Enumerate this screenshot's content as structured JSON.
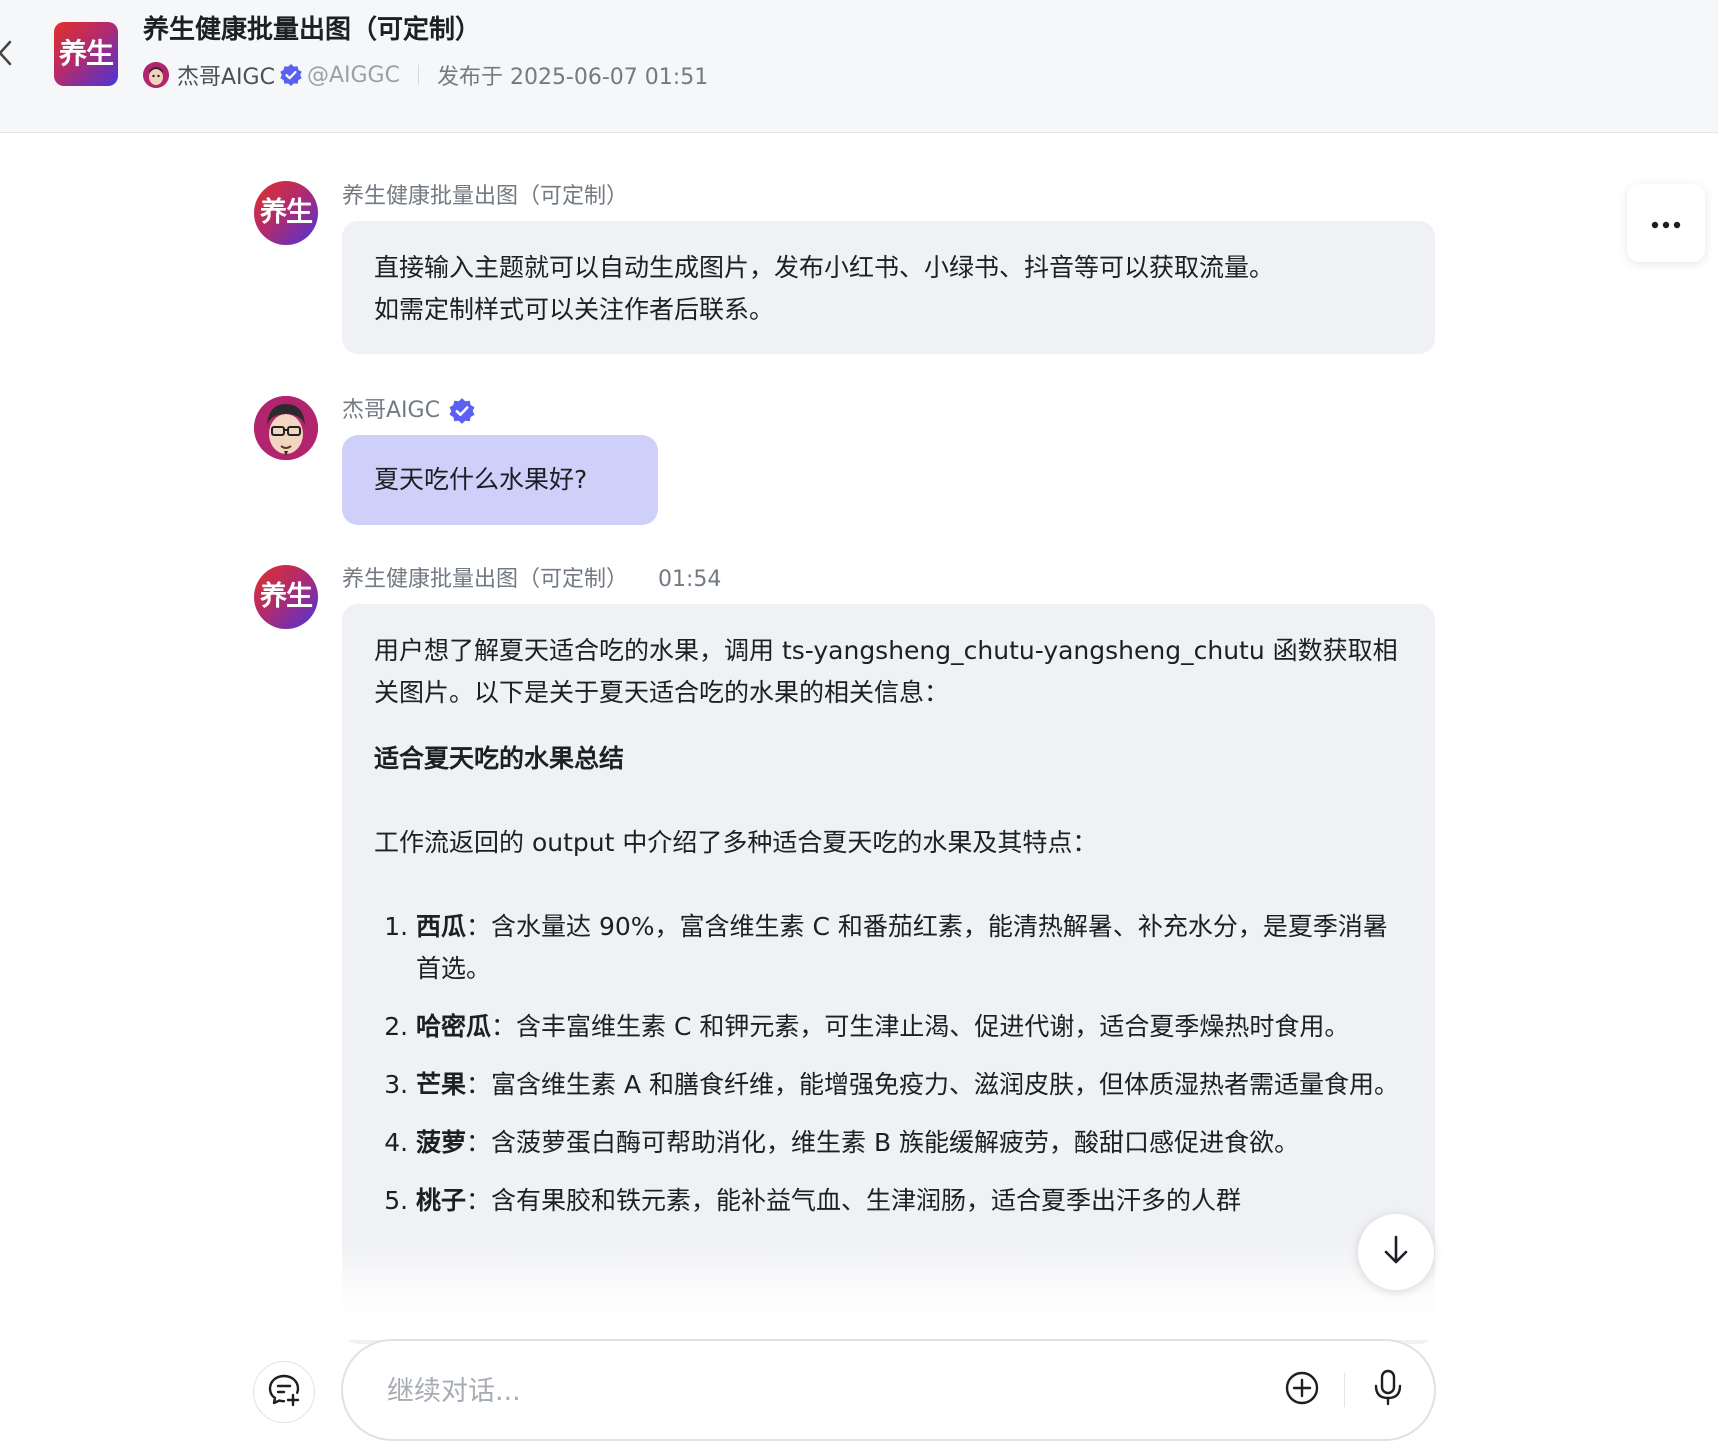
{
  "header": {
    "back_icon": "chevron-left-icon",
    "logo_text": "养生",
    "title": "养生健康批量出图（可定制）",
    "author_name": "杰哥AIGC",
    "author_handle": "@AIGGC",
    "publish_text": "发布于 2025-06-07 01:51",
    "verified_color": "#5b5ff2"
  },
  "messages": [
    {
      "role": "bot",
      "avatar_text": "养生",
      "sender": "养生健康批量出图（可定制）",
      "lines": [
        "直接输入主题就可以自动生成图片，发布小红书、小绿书、抖音等可以获取流量。",
        "如需定制样式可以关注作者后联系。"
      ]
    },
    {
      "role": "user",
      "sender": "杰哥AIGC",
      "text": "夏天吃什么水果好?"
    },
    {
      "role": "bot",
      "avatar_text": "养生",
      "sender": "养生健康批量出图（可定制）",
      "time": "01:54",
      "intro": "用户想了解夏天适合吃的水果，调用 ts-yangsheng_chutu-yangsheng_chutu 函数获取相关图片。以下是关于夏天适合吃的水果的相关信息：",
      "heading": "适合夏天吃的水果总结",
      "summary": "工作流返回的 output 中介绍了多种适合夏天吃的水果及其特点：",
      "items": [
        {
          "name": "西瓜",
          "desc": "：含水量达 90%，富含维生素 C 和番茄红素，能清热解暑、补充水分，是夏季消暑首选。"
        },
        {
          "name": "哈密瓜",
          "desc": "：含丰富维生素 C 和钾元素，可生津止渴、促进代谢，适合夏季燥热时食用。"
        },
        {
          "name": "芒果",
          "desc": "：富含维生素 A 和膳食纤维，能增强免疫力、滋润皮肤，但体质湿热者需适量食用。"
        },
        {
          "name": "菠萝",
          "desc": "：含菠萝蛋白酶可帮助消化，维生素 B 族能缓解疲劳，酸甜口感促进食欲。"
        },
        {
          "name": "桃子",
          "desc": "：含有果胶和铁元素，能补益气血、生津润肠，适合夏季出汗多的人群"
        }
      ]
    }
  ],
  "controls": {
    "more_icon": "more-horizontal-icon",
    "scroll_down_icon": "arrow-down-icon",
    "new_chat_icon": "new-chat-icon",
    "add_icon": "plus-circle-icon",
    "mic_icon": "microphone-icon"
  },
  "input": {
    "placeholder": "继续对话...",
    "value": ""
  }
}
